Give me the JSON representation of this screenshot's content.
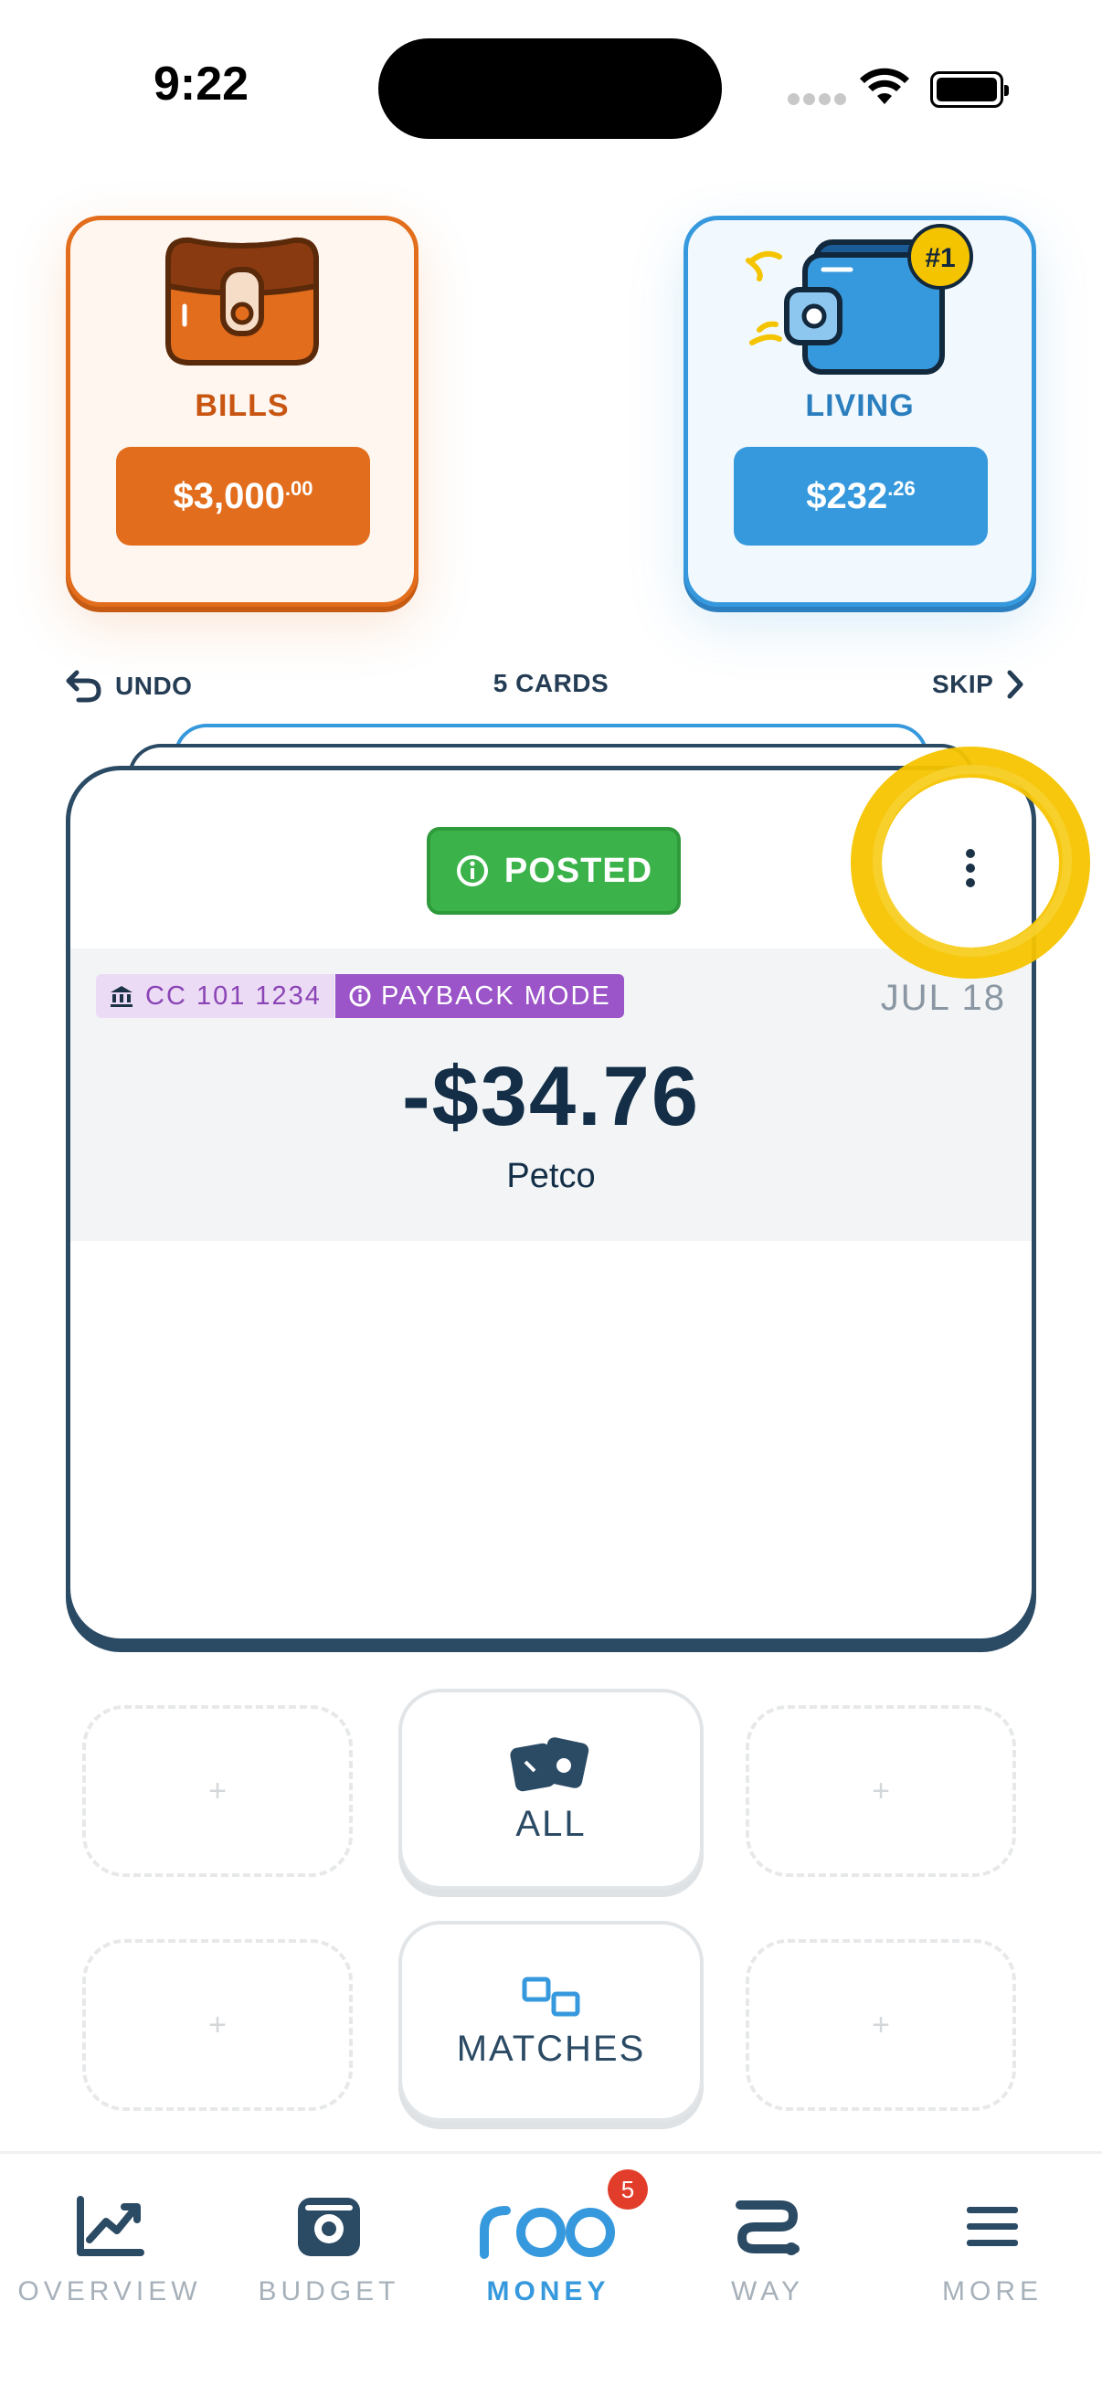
{
  "status_bar": {
    "time": "9:22"
  },
  "envelopes": [
    {
      "label": "BILLS",
      "amount_main": "$3,000",
      "amount_cents": ".00",
      "color": "#e26d1c"
    },
    {
      "label": "LIVING",
      "amount_main": "$232",
      "amount_cents": ".26",
      "color": "#3799dd",
      "rank_badge": "#1"
    }
  ],
  "controls": {
    "undo": "UNDO",
    "cards_count": "5 CARDS",
    "skip": "SKIP"
  },
  "transaction": {
    "status": "POSTED",
    "account": "CC 101 1234",
    "mode": "PAYBACK MODE",
    "date": "JUL 18",
    "amount": "-$34.76",
    "merchant": "Petco"
  },
  "filters": {
    "all_label": "ALL",
    "matches_label": "MATCHES",
    "empty_slot": "+"
  },
  "nav": {
    "items": [
      {
        "label": "OVERVIEW",
        "icon": "chart-trend-icon"
      },
      {
        "label": "BUDGET",
        "icon": "camera-icon"
      },
      {
        "label": "MONEY",
        "icon": "roo-logo-icon",
        "active": true,
        "badge": "5"
      },
      {
        "label": "WAY",
        "icon": "route-icon"
      },
      {
        "label": "MORE",
        "icon": "menu-icon"
      }
    ]
  },
  "colors": {
    "accent": "#3799dd",
    "orange": "#e26d1c",
    "posted_green": "#3cb34a",
    "payback_purple": "#9b55c8",
    "highlight_yellow": "#f5c400"
  }
}
